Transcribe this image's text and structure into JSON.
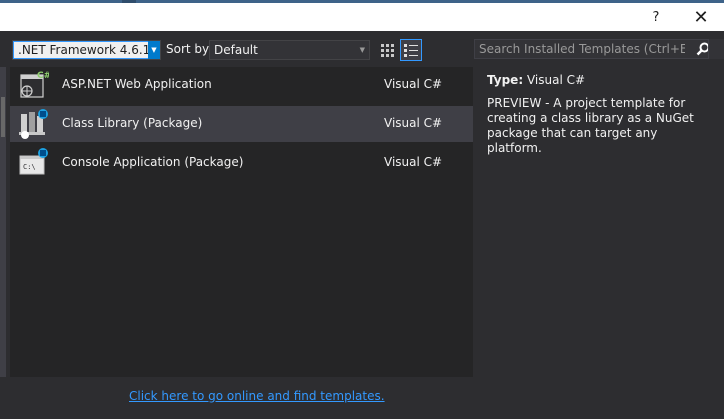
{
  "titlebar": {
    "help_label": "?",
    "close_label": "✕"
  },
  "toolbar": {
    "framework_selected": ".NET Framework 4.6.1",
    "sort_label": "Sort by:",
    "sort_selected": "Default",
    "view_grid_icon": "small-icons-view-icon",
    "view_list_icon": "list-view-icon"
  },
  "search": {
    "placeholder": "Search Installed Templates (Ctrl+E)",
    "icon": "search-icon"
  },
  "templates": [
    {
      "name": "ASP.NET Web Application",
      "language": "Visual C#",
      "icon": "aspnet-web-app-icon",
      "selected": false
    },
    {
      "name": "Class Library (Package)",
      "language": "Visual C#",
      "icon": "class-library-package-icon",
      "selected": true
    },
    {
      "name": "Console Application (Package)",
      "language": "Visual C#",
      "icon": "console-app-package-icon",
      "selected": false
    }
  ],
  "details": {
    "type_key": "Type:",
    "type_value": "Visual C#",
    "description": "PREVIEW - A project template for creating a class library as a NuGet package that can target any platform."
  },
  "footer": {
    "online_link": "Click here to go online and find templates."
  },
  "colors": {
    "accent": "#007acc",
    "link": "#3399ff",
    "background": "#2d2d30",
    "list_background": "#252526",
    "selected_row": "#3f3f46"
  }
}
